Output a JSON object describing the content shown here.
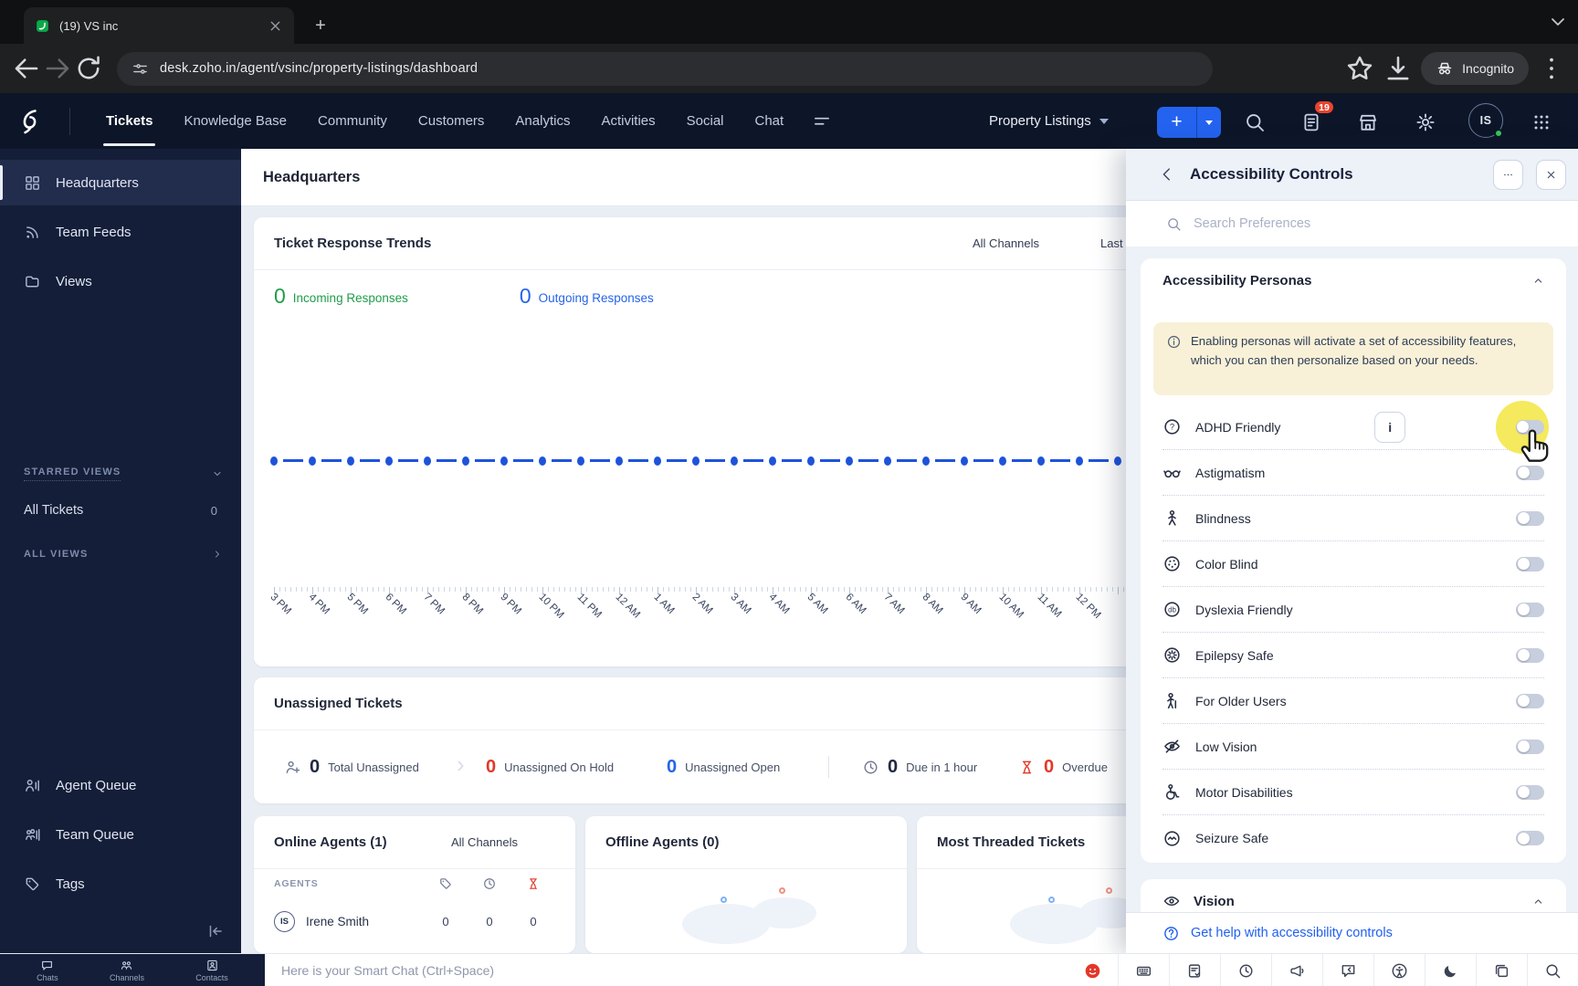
{
  "colors": {
    "accent": "#2563eb",
    "green": "#1f9d49",
    "red": "#e03a2a",
    "chartblue": "#1d53db",
    "link": "#2160f0",
    "navy": "#141e38",
    "navbar": "#0d1628",
    "toggle": "#c7cedd",
    "halo": "#f4e74f",
    "badge": "#e8442e",
    "panelbg": "#edf1f8",
    "mainbg": "#e9edf4"
  },
  "browser": {
    "tab_title": "(19) VS inc",
    "url": "desk.zoho.in/agent/vsinc/property-listings/dashboard",
    "incognito_label": "Incognito"
  },
  "nav": {
    "items": [
      {
        "label": "Tickets",
        "active": true
      },
      {
        "label": "Knowledge Base"
      },
      {
        "label": "Community"
      },
      {
        "label": "Customers"
      },
      {
        "label": "Analytics"
      },
      {
        "label": "Activities"
      },
      {
        "label": "Social"
      },
      {
        "label": "Chat"
      }
    ],
    "department": "Property Listings",
    "notification_count": "19",
    "avatar_initials": "IS"
  },
  "sidebar": {
    "primary": [
      {
        "icon": "grid-icon",
        "label": "Headquarters",
        "active": true
      },
      {
        "icon": "feeds-icon",
        "label": "Team Feeds"
      },
      {
        "icon": "folder-icon",
        "label": "Views"
      }
    ],
    "starred_header": "STARRED VIEWS",
    "starred": [
      {
        "label": "All Tickets",
        "count": "0"
      }
    ],
    "all_views_label": "ALL VIEWS",
    "queues": [
      {
        "icon": "agent-queue-icon",
        "label": "Agent Queue"
      },
      {
        "icon": "team-queue-icon",
        "label": "Team Queue"
      },
      {
        "icon": "tag-icon",
        "label": "Tags"
      }
    ]
  },
  "main": {
    "page_title": "Headquarters",
    "trends": {
      "title": "Ticket Response Trends",
      "channel_filter": "All Channels",
      "range_filter": "Last",
      "legend": [
        {
          "value": "0",
          "label": "Incoming Responses"
        },
        {
          "value": "0",
          "label": "Outgoing Responses"
        }
      ]
    },
    "unassigned": {
      "title": "Unassigned Tickets",
      "total": {
        "value": "0",
        "label": "Total Unassigned"
      },
      "on_hold": {
        "value": "0",
        "label": "Unassigned On Hold"
      },
      "open": {
        "value": "0",
        "label": "Unassigned Open"
      },
      "due": {
        "value": "0",
        "label": "Due in 1 hour"
      },
      "overdue": {
        "value": "0",
        "label": "Overdue"
      }
    },
    "agents": {
      "online_title": "Online Agents (1)",
      "channel_filter": "All Channels",
      "column_header": "AGENTS",
      "rows": [
        {
          "initials": "IS",
          "name": "Irene Smith",
          "values": [
            "0",
            "0",
            "0"
          ]
        }
      ],
      "offline_title": "Offline Agents (0)",
      "threaded_title": "Most Threaded Tickets"
    }
  },
  "chart_data": {
    "type": "line",
    "title": "Ticket Response Trends",
    "x": [
      "3 PM",
      "4 PM",
      "5 PM",
      "6 PM",
      "7 PM",
      "8 PM",
      "9 PM",
      "10 PM",
      "11 PM",
      "12 AM",
      "1 AM",
      "2 AM",
      "3 AM",
      "4 AM",
      "5 AM",
      "6 AM",
      "7 AM",
      "8 AM",
      "9 AM",
      "10 AM",
      "11 AM",
      "12 PM"
    ],
    "series": [
      {
        "name": "Incoming Responses",
        "color": "#1f9d49",
        "values": [
          0,
          0,
          0,
          0,
          0,
          0,
          0,
          0,
          0,
          0,
          0,
          0,
          0,
          0,
          0,
          0,
          0,
          0,
          0,
          0,
          0,
          0
        ]
      },
      {
        "name": "Outgoing Responses",
        "color": "#1d53db",
        "values": [
          0,
          0,
          0,
          0,
          0,
          0,
          0,
          0,
          0,
          0,
          0,
          0,
          0,
          0,
          0,
          0,
          0,
          0,
          0,
          0,
          0,
          0
        ]
      }
    ],
    "ylim": [
      0,
      1
    ],
    "grid": false,
    "legend_position": "top-left",
    "line_style": "dashed",
    "note": "Both series are all zeros; rendered as a single flat blue dashed line with point markers"
  },
  "panel": {
    "title": "Accessibility Controls",
    "search_placeholder": "Search Preferences",
    "personas": {
      "title": "Accessibility Personas",
      "info": "Enabling personas will activate a set of accessibility features, which you can then personalize based on your needs.",
      "info_button_label": "i",
      "toggles": [
        {
          "icon": "adhd-icon",
          "label": "ADHD Friendly",
          "info_button": true,
          "highlight": true,
          "state": "off"
        },
        {
          "icon": "astigmatism-icon",
          "label": "Astigmatism",
          "state": "off"
        },
        {
          "icon": "blindness-icon",
          "label": "Blindness",
          "state": "off"
        },
        {
          "icon": "colorblind-icon",
          "label": "Color Blind",
          "state": "off"
        },
        {
          "icon": "dyslexia-icon",
          "label": "Dyslexia Friendly",
          "state": "off"
        },
        {
          "icon": "epilepsy-icon",
          "label": "Epilepsy Safe",
          "state": "off"
        },
        {
          "icon": "older-users-icon",
          "label": "For Older Users",
          "state": "off"
        },
        {
          "icon": "low-vision-icon",
          "label": "Low Vision",
          "state": "off"
        },
        {
          "icon": "motor-icon",
          "label": "Motor Disabilities",
          "state": "off"
        },
        {
          "icon": "seizure-icon",
          "label": "Seizure Safe",
          "state": "off"
        }
      ]
    },
    "vision_title": "Vision",
    "help_label": "Get help with accessibility controls"
  },
  "bottombar": {
    "left_items": [
      {
        "icon": "chat-bubble-icon",
        "label": "Chats"
      },
      {
        "icon": "channels-icon",
        "label": "Channels"
      },
      {
        "icon": "contacts-icon",
        "label": "Contacts"
      }
    ],
    "smart_chat_placeholder": "Here is your Smart Chat (Ctrl+Space)",
    "right_icons": [
      "smiley-icon",
      "keyboard-icon",
      "task-check-icon",
      "clock-icon",
      "announce-icon",
      "reply-arrow-icon",
      "accessibility-icon",
      "moon-icon",
      "copies-icon",
      "search-icon"
    ]
  }
}
